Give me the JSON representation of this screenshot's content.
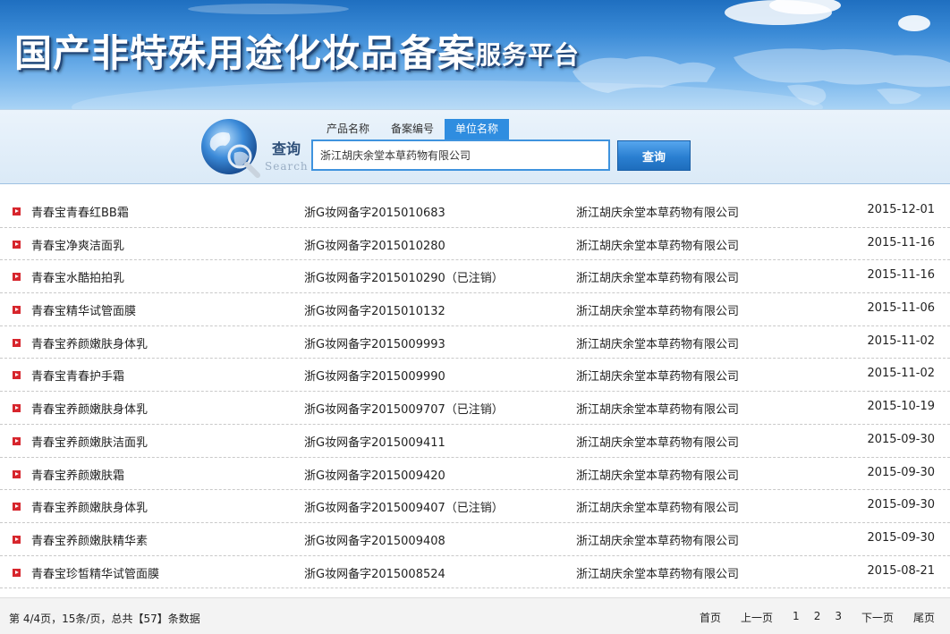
{
  "header": {
    "title": "国产非特殊用途化妆品备案",
    "subtitle": "服务平台"
  },
  "search": {
    "logo_cn": "查询",
    "logo_en": "Search",
    "tabs": [
      {
        "label": "产品名称",
        "active": false
      },
      {
        "label": "备案编号",
        "active": false
      },
      {
        "label": "单位名称",
        "active": true
      }
    ],
    "input_value": "浙江胡庆余堂本草药物有限公司",
    "button_label": "查询"
  },
  "results": [
    {
      "name": "青春宝青春红BB霜",
      "code": "浙G妆网备字2015010683",
      "company": "浙江胡庆余堂本草药物有限公司",
      "date": "2015-12-01"
    },
    {
      "name": "青春宝净爽洁面乳",
      "code": "浙G妆网备字2015010280",
      "company": "浙江胡庆余堂本草药物有限公司",
      "date": "2015-11-16"
    },
    {
      "name": "青春宝水酷拍拍乳",
      "code": "浙G妆网备字2015010290（已注销）",
      "company": "浙江胡庆余堂本草药物有限公司",
      "date": "2015-11-16"
    },
    {
      "name": "青春宝精华试管面膜",
      "code": "浙G妆网备字2015010132",
      "company": "浙江胡庆余堂本草药物有限公司",
      "date": "2015-11-06"
    },
    {
      "name": "青春宝养颜嫩肤身体乳",
      "code": "浙G妆网备字2015009993",
      "company": "浙江胡庆余堂本草药物有限公司",
      "date": "2015-11-02"
    },
    {
      "name": "青春宝青春护手霜",
      "code": "浙G妆网备字2015009990",
      "company": "浙江胡庆余堂本草药物有限公司",
      "date": "2015-11-02"
    },
    {
      "name": "青春宝养颜嫩肤身体乳",
      "code": "浙G妆网备字2015009707（已注销）",
      "company": "浙江胡庆余堂本草药物有限公司",
      "date": "2015-10-19"
    },
    {
      "name": "青春宝养颜嫩肤洁面乳",
      "code": "浙G妆网备字2015009411",
      "company": "浙江胡庆余堂本草药物有限公司",
      "date": "2015-09-30"
    },
    {
      "name": "青春宝养颜嫩肤霜",
      "code": "浙G妆网备字2015009420",
      "company": "浙江胡庆余堂本草药物有限公司",
      "date": "2015-09-30"
    },
    {
      "name": "青春宝养颜嫩肤身体乳",
      "code": "浙G妆网备字2015009407（已注销）",
      "company": "浙江胡庆余堂本草药物有限公司",
      "date": "2015-09-30"
    },
    {
      "name": "青春宝养颜嫩肤精华素",
      "code": "浙G妆网备字2015009408",
      "company": "浙江胡庆余堂本草药物有限公司",
      "date": "2015-09-30"
    },
    {
      "name": "青春宝珍皙精华试管面膜",
      "code": "浙G妆网备字2015008524",
      "company": "浙江胡庆余堂本草药物有限公司",
      "date": "2015-08-21"
    }
  ],
  "footer": {
    "summary": "第 4/4页，15条/页，总共【57】条数据",
    "pagination": {
      "first": "首页",
      "prev": "上一页",
      "pages": [
        "1",
        "2",
        "3"
      ],
      "next": "下一页",
      "last": "尾页"
    }
  },
  "colors": {
    "banner_blue": "#3a8ad6",
    "active_tab": "#2f8de0",
    "bullet_red": "#d7262d"
  }
}
